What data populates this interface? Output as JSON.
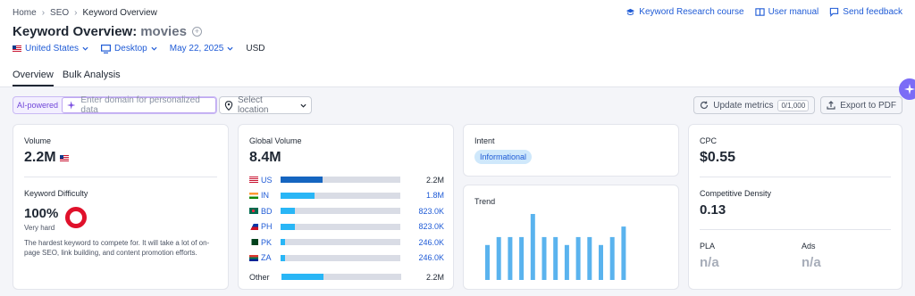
{
  "breadcrumb": [
    "Home",
    "SEO",
    "Keyword Overview"
  ],
  "header_links": {
    "course": "Keyword Research course",
    "manual": "User manual",
    "feedback": "Send feedback"
  },
  "title": {
    "main": "Keyword Overview:",
    "keyword": "movies"
  },
  "filters": {
    "country": "United States",
    "device": "Desktop",
    "date": "May 22, 2025",
    "currency": "USD"
  },
  "tabs": [
    "Overview",
    "Bulk Analysis"
  ],
  "toolbar": {
    "ai_label": "AI-powered",
    "domain_placeholder": "Enter domain for personalized data",
    "location_placeholder": "Select location",
    "update_label": "Update metrics",
    "update_counter": "0/1,000",
    "export_label": "Export to PDF"
  },
  "volume": {
    "label": "Volume",
    "value": "2.2M"
  },
  "difficulty": {
    "label": "Keyword Difficulty",
    "value": "100%",
    "level": "Very hard",
    "description": "The hardest keyword to compete for. It will take a lot of on-page SEO, link building, and content promotion efforts."
  },
  "global_volume": {
    "label": "Global Volume",
    "value": "8.4M",
    "rows": [
      {
        "code": "US",
        "value": "2.2M",
        "share": 0.26
      },
      {
        "code": "IN",
        "value": "1.8M",
        "share": 0.21
      },
      {
        "code": "BD",
        "value": "823.0K",
        "share": 0.09
      },
      {
        "code": "PH",
        "value": "823.0K",
        "share": 0.09
      },
      {
        "code": "PK",
        "value": "246.0K",
        "share": 0.03
      },
      {
        "code": "ZA",
        "value": "246.0K",
        "share": 0.03
      }
    ],
    "other": {
      "label": "Other",
      "value": "2.2M",
      "share": 0.26
    }
  },
  "intent": {
    "label": "Intent",
    "badge": "Informational"
  },
  "trend": {
    "label": "Trend",
    "values": [
      0.53,
      0.65,
      0.65,
      0.65,
      1.0,
      0.65,
      0.65,
      0.53,
      0.65,
      0.65,
      0.53,
      0.65,
      0.81
    ]
  },
  "cpc": {
    "label": "CPC",
    "value": "$0.55"
  },
  "competitive_density": {
    "label": "Competitive Density",
    "value": "0.13"
  },
  "pla": {
    "label": "PLA",
    "value": "n/a"
  },
  "ads": {
    "label": "Ads",
    "value": "n/a"
  },
  "colors": {
    "accent": "#1f5bd6",
    "bar_dark": "#1565c0",
    "bar_light": "#29b6f6",
    "kd_red": "#e0112b",
    "trend_bar": "#5ab3ee"
  }
}
